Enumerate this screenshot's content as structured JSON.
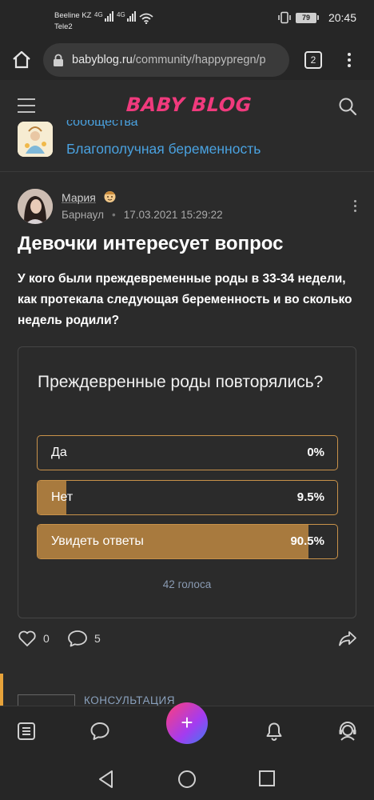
{
  "status": {
    "carrier1": "Beeline KZ",
    "carrier2": "Tele2",
    "net1": "4G",
    "net2": "4G",
    "battery": "79",
    "time": "20:45"
  },
  "browser": {
    "url_domain": "babyblog.ru",
    "url_path": "/community/happypregn/p",
    "tab_count": "2"
  },
  "site": {
    "logo": "BABY BLOG"
  },
  "community": {
    "label": "сообщества",
    "name": "Благополучная беременность"
  },
  "post": {
    "author": "Мария",
    "city": "Барнаул",
    "datetime": "17.03.2021 15:29:22",
    "title": "Девочки интересует вопрос",
    "body": "У кого были преждевременные роды в 33-34 недели, как протекала следующая беременность и во сколько недель родили?",
    "likes": "0",
    "comments": "5"
  },
  "poll": {
    "question": "Преждевренные роды повторялись?",
    "options": [
      {
        "label": "Да",
        "percent": "0%",
        "value": 0
      },
      {
        "label": "Нет",
        "percent": "9.5%",
        "value": 9.5
      },
      {
        "label": "Увидеть ответы",
        "percent": "90.5%",
        "value": 90.5
      }
    ],
    "votes": "42 голоса",
    "bar_color": "#a87a3e",
    "border_color": "#c9924a"
  },
  "next": {
    "label": "КОНСУЛЬТАЦИЯ"
  },
  "icons": {
    "home": "home-icon",
    "lock": "lock-icon",
    "menu": "menu-icon",
    "search": "search-icon",
    "like": "heart-icon",
    "comment": "comment-icon",
    "share": "share-icon",
    "feed": "feed-icon",
    "chat": "chat-icon",
    "plus": "plus-icon",
    "bell": "bell-icon",
    "support": "support-icon"
  },
  "colors": {
    "accent_pink": "#f03a7d",
    "link_blue": "#4aa2e0",
    "background": "#2b2b2b"
  }
}
